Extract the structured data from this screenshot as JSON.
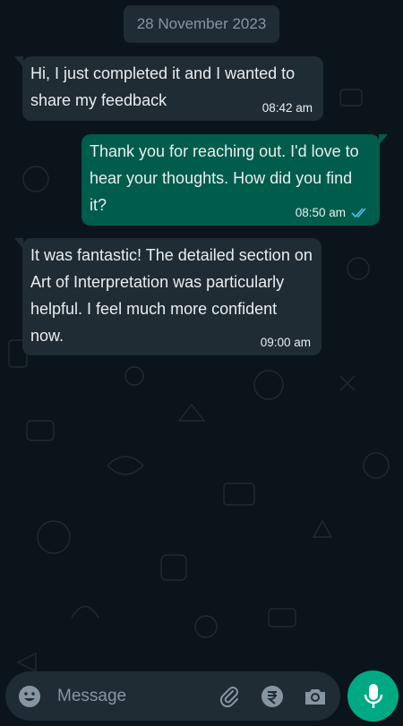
{
  "date_chip": "28 November 2023",
  "messages": [
    {
      "direction": "incoming",
      "text": "Hi, I just completed it and I wanted to share my feedback",
      "time": "08:42 am"
    },
    {
      "direction": "outgoing",
      "text": "Thank you for reaching out. I'd love to hear your thoughts. How did you find it?",
      "time": "08:50 am",
      "status": "read"
    },
    {
      "direction": "incoming",
      "text": "It was fantastic! The detailed section on Art of Interpretation was particularly helpful. I feel much more confident now.",
      "time": "09:00 am"
    }
  ],
  "composer": {
    "placeholder": "Message",
    "icons": [
      "emoji-icon",
      "attachment-icon",
      "rupee-payment-icon",
      "camera-icon",
      "mic-icon"
    ]
  },
  "colors": {
    "background": "#0b141a",
    "incoming_bubble": "#202c33",
    "outgoing_bubble": "#005c4b",
    "accent": "#00a884",
    "read_ticks": "#53bdeb",
    "muted_text": "#8696a0"
  }
}
